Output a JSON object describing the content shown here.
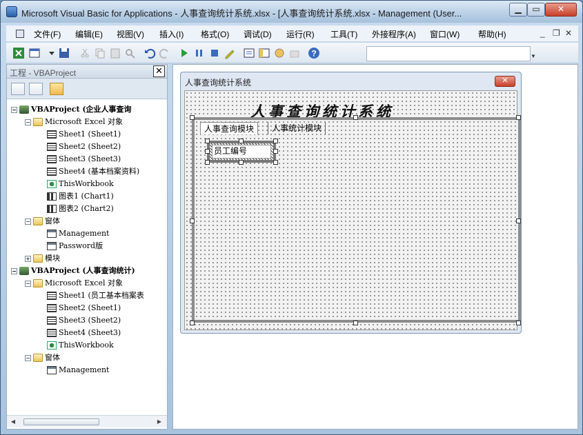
{
  "window": {
    "title": "Microsoft Visual Basic for Applications - 人事查询统计系统.xlsx - [人事查询统计系统.xlsx - Management (User...",
    "min_label": "▁",
    "max_label": "▭",
    "close_label": "✕"
  },
  "menu": {
    "items": [
      "文件(F)",
      "编辑(E)",
      "视图(V)",
      "插入(I)",
      "格式(O)",
      "调试(D)",
      "运行(R)",
      "工具(T)",
      "外接程序(A)",
      "窗口(W)",
      "帮助(H)"
    ],
    "mdi_min": "_",
    "mdi_restore": "❐",
    "mdi_close": "✕"
  },
  "toolbar": {
    "icons": [
      "excel-icon",
      "insert-userform-icon",
      "save-icon",
      "cut-icon",
      "copy-icon",
      "paste-icon",
      "find-icon",
      "undo-icon",
      "redo-icon",
      "run-icon",
      "break-icon",
      "reset-icon",
      "design-mode-icon",
      "project-explorer-icon",
      "properties-icon",
      "object-browser-icon",
      "toolbox-icon",
      "help-icon"
    ]
  },
  "project_panel": {
    "title": "工程 - VBAProject",
    "close": "✕"
  },
  "tree": [
    {
      "label": "VBAProject (企业人事查询",
      "indent": 0,
      "icon": "proj",
      "exp": "−",
      "bold": true
    },
    {
      "label": "Microsoft Excel 对象",
      "indent": 1,
      "icon": "folder",
      "exp": "−"
    },
    {
      "label": "Sheet1 (Sheet1)",
      "indent": 2,
      "icon": "sheet"
    },
    {
      "label": "Sheet2 (Sheet2)",
      "indent": 2,
      "icon": "sheet"
    },
    {
      "label": "Sheet3 (Sheet3)",
      "indent": 2,
      "icon": "sheet"
    },
    {
      "label": "Sheet4 (基本档案资料)",
      "indent": 2,
      "icon": "sheet"
    },
    {
      "label": "ThisWorkbook",
      "indent": 2,
      "icon": "wb"
    },
    {
      "label": "图表1 (Chart1)",
      "indent": 2,
      "icon": "chart"
    },
    {
      "label": "图表2 (Chart2)",
      "indent": 2,
      "icon": "chart"
    },
    {
      "label": "窗体",
      "indent": 1,
      "icon": "folder",
      "exp": "−"
    },
    {
      "label": "Management",
      "indent": 2,
      "icon": "form"
    },
    {
      "label": "Password版",
      "indent": 2,
      "icon": "form"
    },
    {
      "label": "模块",
      "indent": 1,
      "icon": "folder",
      "exp": "+"
    },
    {
      "label": "VBAProject (人事查询统计)",
      "indent": 0,
      "icon": "proj",
      "exp": "−",
      "bold": true
    },
    {
      "label": "Microsoft Excel 对象",
      "indent": 1,
      "icon": "folder",
      "exp": "−"
    },
    {
      "label": "Sheet1 (员工基本档案表",
      "indent": 2,
      "icon": "sheet"
    },
    {
      "label": "Sheet2 (Sheet1)",
      "indent": 2,
      "icon": "sheet"
    },
    {
      "label": "Sheet3 (Sheet2)",
      "indent": 2,
      "icon": "sheet"
    },
    {
      "label": "Sheet4 (Sheet3)",
      "indent": 2,
      "icon": "sheet"
    },
    {
      "label": "ThisWorkbook",
      "indent": 2,
      "icon": "wb"
    },
    {
      "label": "窗体",
      "indent": 1,
      "icon": "folder",
      "exp": "−"
    },
    {
      "label": "Management",
      "indent": 2,
      "icon": "form"
    }
  ],
  "form": {
    "title": "人事查询统计系统",
    "close": "✕",
    "heading": "人事查询统计系统",
    "tabs": [
      "人事查询模块",
      "人事统计模块"
    ],
    "label_caption": "员工编号"
  }
}
